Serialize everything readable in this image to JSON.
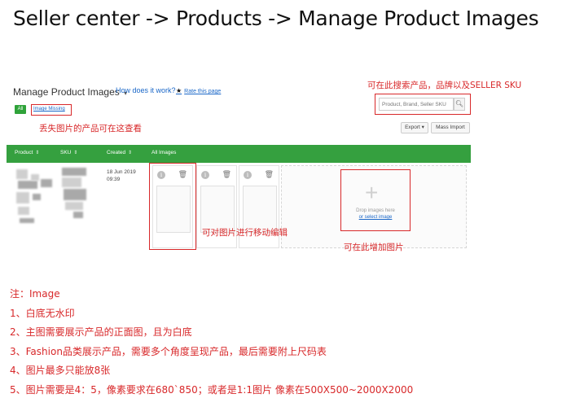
{
  "headline": "Seller center -> Products -> Manage  Product Images",
  "page": {
    "title": "Manage Product Images",
    "title_caret": "▾",
    "how_link": "How does it work?",
    "rate_link": "Rate this page"
  },
  "tabs": [
    {
      "label": "All"
    },
    {
      "label": "Image Missing"
    }
  ],
  "search": {
    "placeholder": "Product, Brand, Seller SKU",
    "icon": "search-icon"
  },
  "toolbar": {
    "export_label": "Export ▾",
    "import_label": "Mass Import"
  },
  "table": {
    "headers": [
      "Product",
      "SKU",
      "Created",
      "All Images"
    ],
    "sort_glyph": "⇕",
    "row": {
      "created_date": "18 Jun 2019",
      "created_time": "09:39"
    }
  },
  "image_slots": [
    {
      "info_icon": "i",
      "trash_icon": "🗑"
    },
    {
      "info_icon": "i",
      "trash_icon": "🗑"
    },
    {
      "info_icon": "i",
      "trash_icon": "🗑"
    }
  ],
  "dropzone": {
    "plus": "+",
    "text": "Drop images here",
    "link": "or select image"
  },
  "annotations": {
    "search_note": "可在此搜索产品，品牌以及SELLER SKU",
    "missing_note": "丢失图片的产品可在这查看",
    "edit_note": "可对图片进行移动编辑",
    "add_note": "可在此增加图片"
  },
  "notes": [
    "注：Image",
    "1、白底无水印",
    "2、主图需要展示产品的正面图，且为白底",
    "3、Fashion品类展示产品，需要多个角度呈现产品，最后需要附上尺码表",
    "4、图片最多只能放8张",
    "5、图片需要是4：5，像素要求在680`850；或者是1:1图片 像素在500X500~2000X2000"
  ],
  "colors": {
    "accent_green": "#35a03f",
    "annotation_red": "#d8282a",
    "link_blue": "#1a67c8"
  }
}
